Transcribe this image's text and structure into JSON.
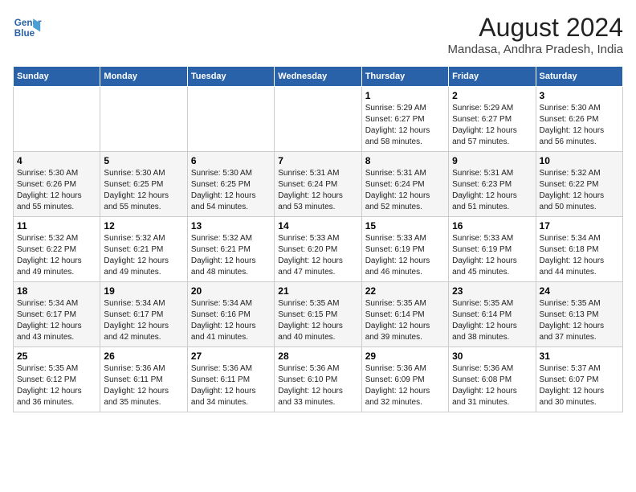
{
  "header": {
    "logo_line1": "General",
    "logo_line2": "Blue",
    "main_title": "August 2024",
    "subtitle": "Mandasa, Andhra Pradesh, India"
  },
  "calendar": {
    "days_of_week": [
      "Sunday",
      "Monday",
      "Tuesday",
      "Wednesday",
      "Thursday",
      "Friday",
      "Saturday"
    ],
    "weeks": [
      [
        {
          "day": "",
          "info": ""
        },
        {
          "day": "",
          "info": ""
        },
        {
          "day": "",
          "info": ""
        },
        {
          "day": "",
          "info": ""
        },
        {
          "day": "1",
          "info": "Sunrise: 5:29 AM\nSunset: 6:27 PM\nDaylight: 12 hours\nand 58 minutes."
        },
        {
          "day": "2",
          "info": "Sunrise: 5:29 AM\nSunset: 6:27 PM\nDaylight: 12 hours\nand 57 minutes."
        },
        {
          "day": "3",
          "info": "Sunrise: 5:30 AM\nSunset: 6:26 PM\nDaylight: 12 hours\nand 56 minutes."
        }
      ],
      [
        {
          "day": "4",
          "info": "Sunrise: 5:30 AM\nSunset: 6:26 PM\nDaylight: 12 hours\nand 55 minutes."
        },
        {
          "day": "5",
          "info": "Sunrise: 5:30 AM\nSunset: 6:25 PM\nDaylight: 12 hours\nand 55 minutes."
        },
        {
          "day": "6",
          "info": "Sunrise: 5:30 AM\nSunset: 6:25 PM\nDaylight: 12 hours\nand 54 minutes."
        },
        {
          "day": "7",
          "info": "Sunrise: 5:31 AM\nSunset: 6:24 PM\nDaylight: 12 hours\nand 53 minutes."
        },
        {
          "day": "8",
          "info": "Sunrise: 5:31 AM\nSunset: 6:24 PM\nDaylight: 12 hours\nand 52 minutes."
        },
        {
          "day": "9",
          "info": "Sunrise: 5:31 AM\nSunset: 6:23 PM\nDaylight: 12 hours\nand 51 minutes."
        },
        {
          "day": "10",
          "info": "Sunrise: 5:32 AM\nSunset: 6:22 PM\nDaylight: 12 hours\nand 50 minutes."
        }
      ],
      [
        {
          "day": "11",
          "info": "Sunrise: 5:32 AM\nSunset: 6:22 PM\nDaylight: 12 hours\nand 49 minutes."
        },
        {
          "day": "12",
          "info": "Sunrise: 5:32 AM\nSunset: 6:21 PM\nDaylight: 12 hours\nand 49 minutes."
        },
        {
          "day": "13",
          "info": "Sunrise: 5:32 AM\nSunset: 6:21 PM\nDaylight: 12 hours\nand 48 minutes."
        },
        {
          "day": "14",
          "info": "Sunrise: 5:33 AM\nSunset: 6:20 PM\nDaylight: 12 hours\nand 47 minutes."
        },
        {
          "day": "15",
          "info": "Sunrise: 5:33 AM\nSunset: 6:19 PM\nDaylight: 12 hours\nand 46 minutes."
        },
        {
          "day": "16",
          "info": "Sunrise: 5:33 AM\nSunset: 6:19 PM\nDaylight: 12 hours\nand 45 minutes."
        },
        {
          "day": "17",
          "info": "Sunrise: 5:34 AM\nSunset: 6:18 PM\nDaylight: 12 hours\nand 44 minutes."
        }
      ],
      [
        {
          "day": "18",
          "info": "Sunrise: 5:34 AM\nSunset: 6:17 PM\nDaylight: 12 hours\nand 43 minutes."
        },
        {
          "day": "19",
          "info": "Sunrise: 5:34 AM\nSunset: 6:17 PM\nDaylight: 12 hours\nand 42 minutes."
        },
        {
          "day": "20",
          "info": "Sunrise: 5:34 AM\nSunset: 6:16 PM\nDaylight: 12 hours\nand 41 minutes."
        },
        {
          "day": "21",
          "info": "Sunrise: 5:35 AM\nSunset: 6:15 PM\nDaylight: 12 hours\nand 40 minutes."
        },
        {
          "day": "22",
          "info": "Sunrise: 5:35 AM\nSunset: 6:14 PM\nDaylight: 12 hours\nand 39 minutes."
        },
        {
          "day": "23",
          "info": "Sunrise: 5:35 AM\nSunset: 6:14 PM\nDaylight: 12 hours\nand 38 minutes."
        },
        {
          "day": "24",
          "info": "Sunrise: 5:35 AM\nSunset: 6:13 PM\nDaylight: 12 hours\nand 37 minutes."
        }
      ],
      [
        {
          "day": "25",
          "info": "Sunrise: 5:35 AM\nSunset: 6:12 PM\nDaylight: 12 hours\nand 36 minutes."
        },
        {
          "day": "26",
          "info": "Sunrise: 5:36 AM\nSunset: 6:11 PM\nDaylight: 12 hours\nand 35 minutes."
        },
        {
          "day": "27",
          "info": "Sunrise: 5:36 AM\nSunset: 6:11 PM\nDaylight: 12 hours\nand 34 minutes."
        },
        {
          "day": "28",
          "info": "Sunrise: 5:36 AM\nSunset: 6:10 PM\nDaylight: 12 hours\nand 33 minutes."
        },
        {
          "day": "29",
          "info": "Sunrise: 5:36 AM\nSunset: 6:09 PM\nDaylight: 12 hours\nand 32 minutes."
        },
        {
          "day": "30",
          "info": "Sunrise: 5:36 AM\nSunset: 6:08 PM\nDaylight: 12 hours\nand 31 minutes."
        },
        {
          "day": "31",
          "info": "Sunrise: 5:37 AM\nSunset: 6:07 PM\nDaylight: 12 hours\nand 30 minutes."
        }
      ]
    ]
  }
}
